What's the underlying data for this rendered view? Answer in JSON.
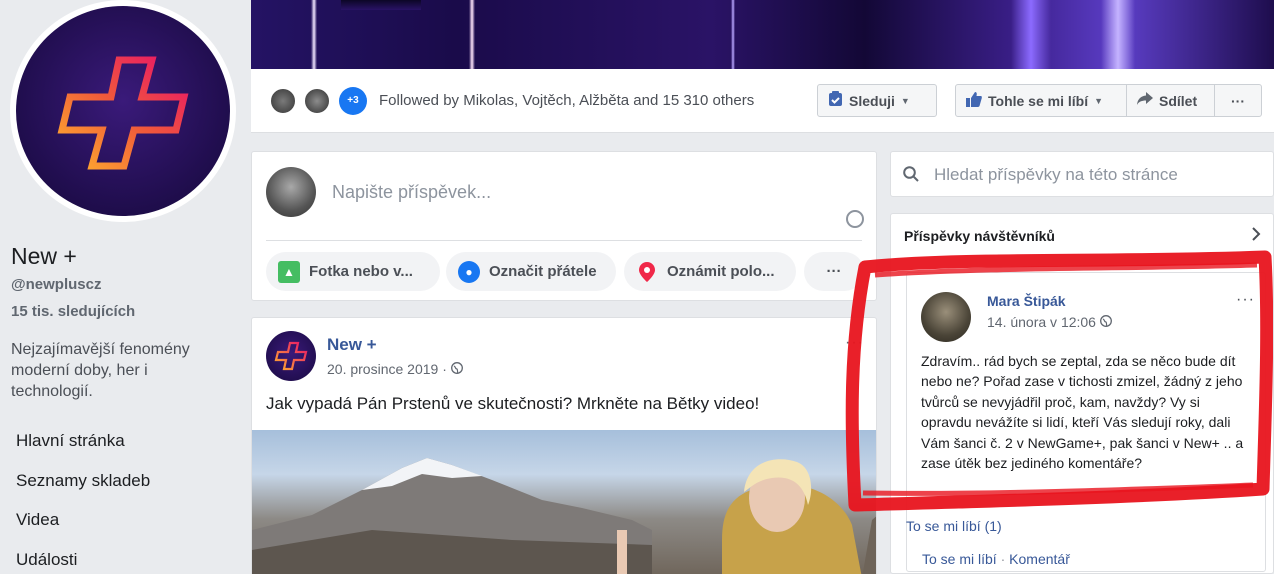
{
  "page": {
    "name": "New +",
    "handle": "@newpluscz",
    "followers": "15 tis. sledujících",
    "about": "Nejzajímavější fenomény moderní doby, her i technologií."
  },
  "nav": {
    "items": [
      "Hlavní stránka",
      "Seznamy skladeb",
      "Videa",
      "Události"
    ]
  },
  "actionbar": {
    "more_followers_badge": "+3",
    "followed_text": "Followed by Mikolas, Vojtěch, Alžběta and 15 310 others",
    "follow_label": "Sleduji",
    "like_label": "Tohle se mi líbí",
    "share_label": "Sdílet",
    "more_label": "···"
  },
  "composer": {
    "placeholder": "Napište příspěvek...",
    "photo_label": "Fotka nebo v...",
    "tag_label": "Označit přátele",
    "checkin_label": "Oznámit polo...",
    "more_label": "···"
  },
  "post": {
    "author": "New +",
    "date": "20. prosince 2019 · ",
    "text": "Jak vypadá Pán Prstenů ve skutečnosti? Mrkněte na Bětky video!",
    "more_label": "···"
  },
  "search": {
    "placeholder": "Hledat příspěvky na této stránce"
  },
  "visitor_posts": {
    "title": "Příspěvky návštěvníků",
    "post": {
      "author": "Mara Štipák",
      "date": "14. února v 12:06 ",
      "body": "Zdravím.. rád bych se zeptal, zda se něco bude dít nebo ne? Pořad zase v tichosti zmizel, žádný z jeho tvůrců se nevyjádřil proč, kam, navždy? Vy si opravdu nevážíte si lidí, kteří Vás sledují roky, dali Vám šanci č. 2 v NewGame+, pak šanci v New+ .. a zase útěk bez jediného komentáře?",
      "likes": "To se mi líbí (1)",
      "action_like": "To se mi líbí",
      "action_sep": " · ",
      "action_comment": "Komentář",
      "more_label": "···"
    }
  },
  "colors": {
    "link_blue": "#385898",
    "fb_blue": "#4267b2",
    "annotation_red": "#e8141e",
    "brand_gradient_start": "#ffb02e",
    "brand_gradient_end": "#e8126a"
  },
  "icons": [
    "plus-logo-icon",
    "clipboard-check-icon",
    "thumbs-up-icon",
    "share-arrow-icon",
    "emoji-icon",
    "photo-icon",
    "tag-friends-icon",
    "location-pin-icon",
    "globe-icon",
    "search-icon",
    "chevron-right-icon",
    "caret-down-icon"
  ]
}
